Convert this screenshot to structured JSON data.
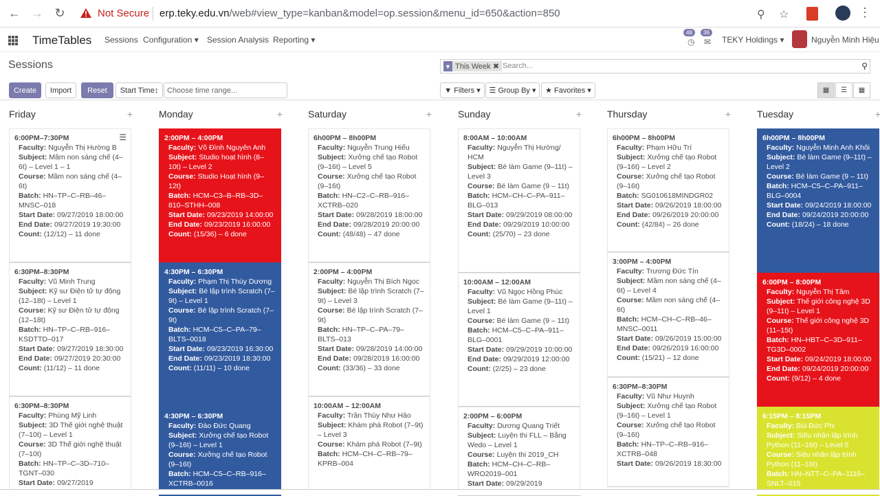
{
  "browser": {
    "not_secure": "Not Secure",
    "url_host": "erp.teky.edu.vn",
    "url_path": "/web#view_type=kanban&model=op.session&menu_id=650&action=850"
  },
  "app": {
    "title": "TimeTables",
    "menu": [
      "Sessions",
      "Configuration",
      "Session Analysis",
      "Reporting"
    ],
    "badge_activity": "48",
    "badge_messages": "36",
    "company": "TEKY Holdings",
    "user": "Nguyễn Minh Hiệu"
  },
  "control": {
    "breadcrumb": "Sessions",
    "create": "Create",
    "import": "Import",
    "reset": "Reset",
    "start_time": "Start Time",
    "range_placeholder": "Choose time range...",
    "facet": "This Week",
    "search_placeholder": "Search...",
    "filters": "Filters",
    "group_by": "Group By",
    "favorites": "Favorites"
  },
  "columns": [
    {
      "name": "Friday",
      "cards": [
        {
          "time": "6:00PM–7:30PM",
          "color": "white",
          "lines": [
            [
              "Faculty:",
              "Nguyễn Thị Hường B"
            ],
            [
              "Subject:",
              "Mầm non sáng chế (4–6t) – Level 1 – 1"
            ],
            [
              "Course:",
              "Mầm non sáng chế (4–6t)"
            ],
            [
              "Batch:",
              "HN–TP–C–RB–46–MNSC–018"
            ],
            [
              "Start Date:",
              "09/27/2019 18:00:00"
            ],
            [
              "End Date:",
              "09/27/2019 19:30:00"
            ],
            [
              "Count:",
              "(12/12) – 11 done"
            ]
          ]
        },
        {
          "time": "6:30PM–8:30PM",
          "color": "white",
          "lines": [
            [
              "Faculty:",
              "Vũ Minh Trung"
            ],
            [
              "Subject:",
              "Kỹ sư Điện tử tự động (12–18t) – Level 1"
            ],
            [
              "Course:",
              "Kỹ sư Điện tử tự động (12–18t)"
            ],
            [
              "Batch:",
              "HN–TP–C–RB–916–KSDTTD–017"
            ],
            [
              "Start Date:",
              "09/27/2019 18:30:00"
            ],
            [
              "End Date:",
              "09/27/2019 20:30:00"
            ],
            [
              "Count:",
              "(11/12) – 11 done"
            ]
          ]
        },
        {
          "time": "6:30PM–8:30PM",
          "color": "white",
          "lines": [
            [
              "Faculty:",
              "Phùng Mỹ Linh"
            ],
            [
              "Subject:",
              "3D Thế giới nghệ thuật (7–10t) – Level 1"
            ],
            [
              "Course:",
              "3D Thế giới nghệ thuật (7–10t)"
            ],
            [
              "Batch:",
              "HN–TP–C–3D–710–TGNT–030"
            ],
            [
              "Start Date:",
              "09/27/2019"
            ]
          ]
        }
      ]
    },
    {
      "name": "Monday",
      "cards": [
        {
          "time": "2:00PM – 4:00PM",
          "color": "red",
          "lines": [
            [
              "Faculty:",
              "Võ Đình Nguyên Anh"
            ],
            [
              "Subject:",
              "Studio hoạt hình (8–10t) – Level 2"
            ],
            [
              "Course:",
              "Studio Hoạt hình (9–12t)"
            ],
            [
              "Batch:",
              "HCM–C3–B–RB–3D–810–STHH–008"
            ],
            [
              "Start Date:",
              "09/23/2019 14:00:00"
            ],
            [
              "End Date:",
              "09/23/2019 16:00:00"
            ],
            [
              "Count:",
              "(15/36) – 6 done"
            ]
          ]
        },
        {
          "time": "4:30PM – 6:30PM",
          "color": "blue",
          "lines": [
            [
              "Faculty:",
              "Phạm Thị Thùy Dương"
            ],
            [
              "Subject:",
              "Bé lập trình Scratch (7–9t) – Level 1"
            ],
            [
              "Course:",
              "Bé lập trình Scratch (7–9t)"
            ],
            [
              "Batch:",
              "HCM–C5–C–PA–79–BLTS–0018"
            ],
            [
              "Start Date:",
              "09/23/2019 16:30:00"
            ],
            [
              "End Date:",
              "09/23/2019 18:30:00"
            ],
            [
              "Count:",
              "(11/11) – 10 done"
            ]
          ]
        },
        {
          "time": "4:30PM – 6:30PM",
          "color": "blue",
          "lines": [
            [
              "Faculty:",
              "Đào Đức Quang"
            ],
            [
              "Subject:",
              "Xưởng chế tạo Robot (9–16t) – Level 1"
            ],
            [
              "Course:",
              "Xưởng chế tạo Robot (9–16t)"
            ],
            [
              "Batch:",
              "HCM–C5–C–RB–916–XCTRB–0016"
            ]
          ]
        }
      ]
    },
    {
      "name": "Saturday",
      "cards": [
        {
          "time": "6h00PM – 8h00PM",
          "color": "white",
          "lines": [
            [
              "Faculty:",
              "Nguyễn Trung Hiếu"
            ],
            [
              "Subject:",
              "Xưởng chế tạo Robot (9–16t) – Level 5"
            ],
            [
              "Course:",
              "Xưởng chế tạo Robot (9–16t)"
            ],
            [
              "Batch:",
              "HN–C2–C–RB–916–XCTRB–020"
            ],
            [
              "Start Date:",
              "09/28/2019 18:00:00"
            ],
            [
              "End Date:",
              "09/28/2019 20:00:00"
            ],
            [
              "Count:",
              "(48/48) – 47 done"
            ]
          ]
        },
        {
          "time": "2:00PM – 4:00PM",
          "color": "white",
          "lines": [
            [
              "Faculty:",
              "Nguyễn Thị Bích Ngọc"
            ],
            [
              "Subject:",
              "Bé lập trình Scratch (7–9t) – Level 3"
            ],
            [
              "Course:",
              "Bé lập trình Scratch (7–9t)"
            ],
            [
              "Batch:",
              "HN–TP–C–PA–79–BLTS–013"
            ],
            [
              "Start Date:",
              "09/28/2019 14:00:00"
            ],
            [
              "End Date:",
              "09/28/2019 16:00:00"
            ],
            [
              "Count:",
              "(33/36) – 33 done"
            ]
          ]
        },
        {
          "time": "10:00AM – 12:00AM",
          "color": "white",
          "lines": [
            [
              "Faculty:",
              "Trần Thùy Như Hảo"
            ],
            [
              "Subject:",
              "Khám phá Robot (7–9t) – Level 3"
            ],
            [
              "Course:",
              "Khám phá Robot (7–9t)"
            ],
            [
              "Batch:",
              "HCM–CH–C–RB–79–KPRB–004"
            ]
          ]
        }
      ]
    },
    {
      "name": "Sunday",
      "cards": [
        {
          "time": "8:00AM – 10:00AM",
          "color": "white",
          "lines": [
            [
              "Faculty:",
              "Nguyễn Thị Hường/ HCM"
            ],
            [
              "Subject:",
              "Bé làm Game (9–11t) – Level 3"
            ],
            [
              "Course:",
              "Bé làm Game (9 – 11t)"
            ],
            [
              "Batch:",
              "HCM–CH–C–PA–911–BLG–013"
            ],
            [
              "Start Date:",
              "09/29/2019 08:00:00"
            ],
            [
              "End Date:",
              "09/29/2019 10:00:00"
            ],
            [
              "Count:",
              "(25/70) – 23 done"
            ]
          ]
        },
        {
          "time": "10:00AM – 12:00AM",
          "color": "white",
          "lines": [
            [
              "Faculty:",
              "Vũ Ngọc Hồng Phúc"
            ],
            [
              "Subject:",
              "Bé làm Game (9–11t) – Level 1"
            ],
            [
              "Course:",
              "Bé làm Game (9 – 11t)"
            ],
            [
              "Batch:",
              "HCM–C5–C–PA–911–BLG–0001"
            ],
            [
              "Start Date:",
              "09/29/2019 10:00:00"
            ],
            [
              "End Date:",
              "09/29/2019 12:00:00"
            ],
            [
              "Count:",
              "(2/25) – 23 done"
            ]
          ]
        },
        {
          "time": "2:00PM – 6:00PM",
          "color": "white",
          "lines": [
            [
              "Faculty:",
              "Dương Quang Triết"
            ],
            [
              "Subject:",
              "Luyện thi FLL – Bằng Wedo – Level 1"
            ],
            [
              "Course:",
              "Luyện thi 2019_CH"
            ],
            [
              "Batch:",
              "HCM–CH–C–RB–WRO2019–001"
            ],
            [
              "Start Date:",
              "09/29/2019"
            ]
          ]
        }
      ]
    },
    {
      "name": "Thursday",
      "cards": [
        {
          "time": "6h00PM – 8h00PM",
          "color": "white",
          "lines": [
            [
              "Faculty:",
              "Phạm Hữu Trí"
            ],
            [
              "Subject:",
              "Xưởng chế tạo Robot (9–16t) – Level 2"
            ],
            [
              "Course:",
              "Xưởng chế tạo Robot (9–16t)"
            ],
            [
              "Batch:",
              "SG010618MINDGR02"
            ],
            [
              "Start Date:",
              "09/26/2019 18:00:00"
            ],
            [
              "End Date:",
              "09/26/2019 20:00:00"
            ],
            [
              "Count:",
              "(42/84) – 26 done"
            ]
          ]
        },
        {
          "time": "3:00PM – 4:00PM",
          "color": "white",
          "lines": [
            [
              "Faculty:",
              "Trương Đức Tín"
            ],
            [
              "Subject:",
              "Mầm non sáng chế (4–6t) – Level 4"
            ],
            [
              "Course:",
              "Mầm non sáng chế (4–6t)"
            ],
            [
              "Batch:",
              "HCM–CH–C–RB–46–MNSC–0011"
            ],
            [
              "Start Date:",
              "09/26/2019 15:00:00"
            ],
            [
              "End Date:",
              "09/26/2019 16:00:00"
            ],
            [
              "Count:",
              "(15/21) – 12 done"
            ]
          ]
        },
        {
          "time": "6:30PM–8:30PM",
          "color": "white",
          "lines": [
            [
              "Faculty:",
              "Vũ Như Huynh"
            ],
            [
              "Subject:",
              "Xưởng chế tạo Robot (9–16t) – Level 1"
            ],
            [
              "Course:",
              "Xưởng chế tạo Robot (9–16t)"
            ],
            [
              "Batch:",
              "HN–TP–C–RB–916–XCTRB–048"
            ],
            [
              "Start Date:",
              "09/26/2019 18:30:00"
            ]
          ]
        }
      ]
    },
    {
      "name": "Tuesday",
      "cards": [
        {
          "time": "6h00PM – 8h00PM",
          "color": "blue",
          "lines": [
            [
              "Faculty:",
              "Nguyễn Minh Anh Khôi"
            ],
            [
              "Subject:",
              "Bé làm Game (9–11t) – Level 2"
            ],
            [
              "Course:",
              "Bé làm Game (9 – 11t)"
            ],
            [
              "Batch:",
              "HCM–C5–C–PA–911–BLG–0004"
            ],
            [
              "Start Date:",
              "09/24/2019 18:00:00"
            ],
            [
              "End Date:",
              "09/24/2019 20:00:00"
            ],
            [
              "Count:",
              "(18/24) – 18 done"
            ]
          ]
        },
        {
          "time": "6:00PM – 8:00PM",
          "color": "red",
          "lines": [
            [
              "Faculty:",
              "Nguyễn Thị Tâm"
            ],
            [
              "Subject:",
              "Thế giới công nghệ 3D (9–11t) – Level 1"
            ],
            [
              "Course:",
              "Thế giới công nghệ 3D (11–15t)"
            ],
            [
              "Batch:",
              "HN–HBT–C–3D–911–TG3D–0002"
            ],
            [
              "Start Date:",
              "09/24/2019 18:00:00"
            ],
            [
              "End Date:",
              "09/24/2019 20:00:00"
            ],
            [
              "Count:",
              "(9/12) – 4 done"
            ]
          ]
        },
        {
          "time": "6:15PM – 8:15PM",
          "color": "green",
          "lines": [
            [
              "Faculty:",
              "Bùi Đức Phi"
            ],
            [
              "Subject:",
              "Siêu nhân lập trình Python (11–16t) – Level 5"
            ],
            [
              "Course:",
              "Siêu nhân lập trình Python (11–16t)"
            ],
            [
              "Batch:",
              "HN–NTT–C–PA–1116–SNLT–015"
            ]
          ]
        }
      ]
    }
  ]
}
